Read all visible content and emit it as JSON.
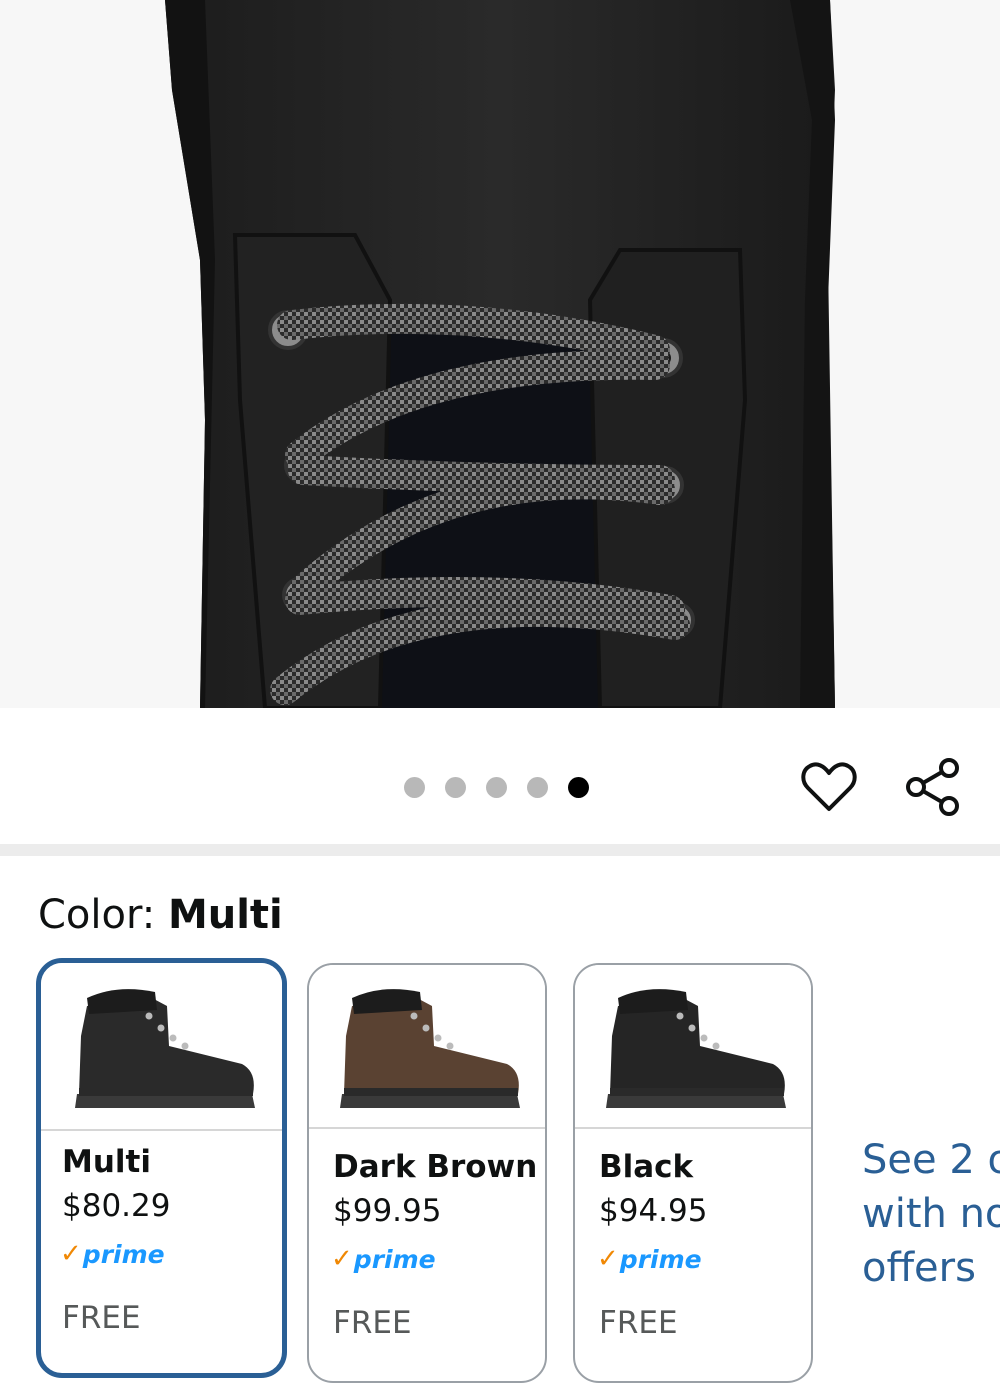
{
  "gallery": {
    "image_alt": "Black leather work boot laces close-up",
    "dot_count": 5,
    "active_index": 4
  },
  "actions": {
    "favorite_icon": "heart-icon",
    "share_icon": "share-icon"
  },
  "color_selector": {
    "label": "Color:",
    "selected_value": "Multi",
    "options": [
      {
        "name": "Multi",
        "price": "$80.29",
        "prime": "prime",
        "shipping": "FREE",
        "boot_color": "#2a2a2a",
        "selected": true
      },
      {
        "name": "Dark Brown",
        "price": "$99.95",
        "prime": "prime",
        "shipping": "FREE",
        "boot_color": "#5a4232",
        "selected": false
      },
      {
        "name": "Black",
        "price": "$94.95",
        "prime": "prime",
        "shipping": "FREE",
        "boot_color": "#252525",
        "selected": false
      }
    ],
    "see_more_lines": [
      "See 2 o",
      "with no",
      "offers"
    ]
  },
  "colors": {
    "selected_border": "#2a5f95",
    "link": "#2a5f95",
    "prime_blue": "#1a98ff",
    "prime_check": "#f08804",
    "dot_active": "#000000",
    "dot_inactive": "#b8b8b8"
  }
}
